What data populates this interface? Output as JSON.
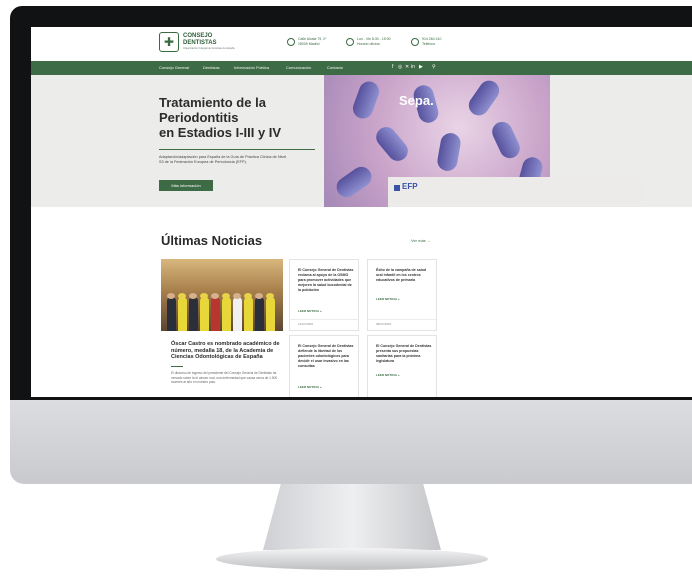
{
  "header": {
    "logo_line1": "CONSEJO",
    "logo_line2": "DENTISTAS",
    "logo_tagline": "Organización Colegial de Dentistas de España",
    "address_line1": "Calle Alcalá 79, 2º",
    "address_line2": "28009 Madrid",
    "hours_line1": "Lun - Vie 8:30 - 15:00",
    "hours_line2": "Horario oficina",
    "phone_line1": "914 264 410",
    "phone_line2": "Teléfono"
  },
  "nav": {
    "items": [
      "Consejo General",
      "Dentistas",
      "Información Pública",
      "Comunicación",
      "Contacto"
    ],
    "social_icons": [
      "facebook-icon",
      "instagram-icon",
      "twitter-icon",
      "linkedin-icon",
      "youtube-icon"
    ],
    "social_glyphs": [
      "f",
      "◎",
      "✕",
      "in",
      "▶"
    ]
  },
  "hero": {
    "title_lines": [
      "Tratamiento de la",
      "Periodontitis",
      "en Estadios I-III y IV"
    ],
    "description": "Adaptación/adaptación para España de la Guía de Práctica Clínica de Nivel S3 de la Federación Europea de Periodoncia (EFP).",
    "button": "Más información",
    "brand": "Sepa.",
    "efp": "EFP"
  },
  "news": {
    "title": "Últimas Noticias",
    "see_more": "Ver más →",
    "feature": {
      "title": "Óscar Castro es nombrado académico de número, medalla 18, de la Academia de Ciencias Odontológicas de España",
      "description": "El discurso de ingreso del presidente del Consejo General de Dentistas ha versado sobre la el cáncer oral, una enfermedad que causa cerca de 1.500 muertes al año en nuestro país."
    },
    "cards": [
      {
        "title": "El Consejo General de Dentistas reclama al apoyo de la OSMO para promover actividades que mejoren la salud bucodental de la población",
        "link": "LEER NOTICIA »",
        "date": "14/07/2025"
      },
      {
        "title": "Éxito de la campaña de salud oral infantil en los centros educativos de primaria",
        "link": "LEER NOTICIA »",
        "date": "08/07/2025"
      },
      {
        "title": "El Consejo General de Dentistas defiende la libertad de los pacientes odontológicos para decidir el usar invasivo en las consultas",
        "link": "LEER NOTICIA »",
        "date": ""
      },
      {
        "title": "El Consejo General de Dentistas presenta sus propuestas sanitarias para la próxima legislatura",
        "link": "LEER NOTICIA »",
        "date": ""
      }
    ]
  },
  "colors": {
    "brand_green": "#3d6b45",
    "hero_bg": "#ececeb",
    "efp_blue": "#3a53a4"
  }
}
